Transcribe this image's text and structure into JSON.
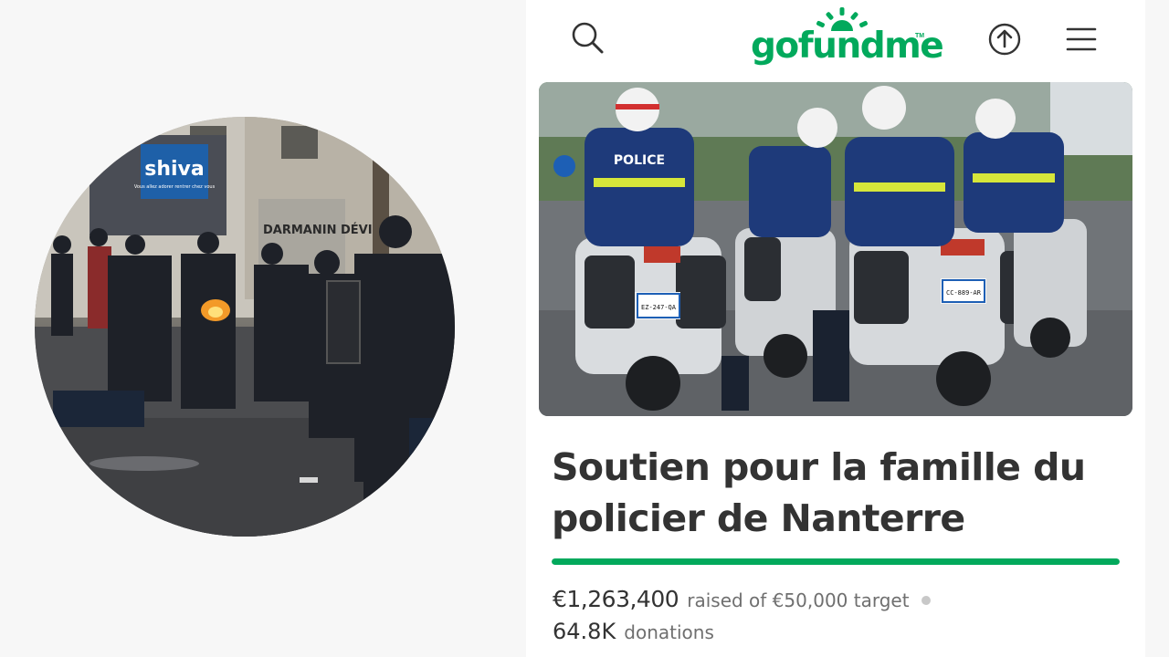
{
  "header": {
    "logo_text": "gofundme",
    "logo_tm": "TM",
    "icons": [
      "search-icon",
      "share-icon",
      "menu-icon"
    ]
  },
  "left_photo": {
    "shop_sign": "shiva",
    "shop_sign_sub": "Vous allez adorer rentrer chez vous",
    "graffiti": "DARMANIN\nDÉVIDER"
  },
  "hero": {
    "police_label": "POLICE",
    "plates": [
      "EZ-247-QA",
      "CC-889-AR"
    ]
  },
  "campaign": {
    "title": "Soutien pour la famille du policier de Nanterre",
    "raised_amount": "€1,263,400",
    "raised_of": "raised of €50,000 target",
    "progress_fraction": 1.0,
    "donations_count": "64.8K",
    "donations_label": "donations"
  },
  "colors": {
    "brand_green": "#02a95c",
    "title_text": "#333333",
    "muted_text": "#6f6f6f"
  }
}
